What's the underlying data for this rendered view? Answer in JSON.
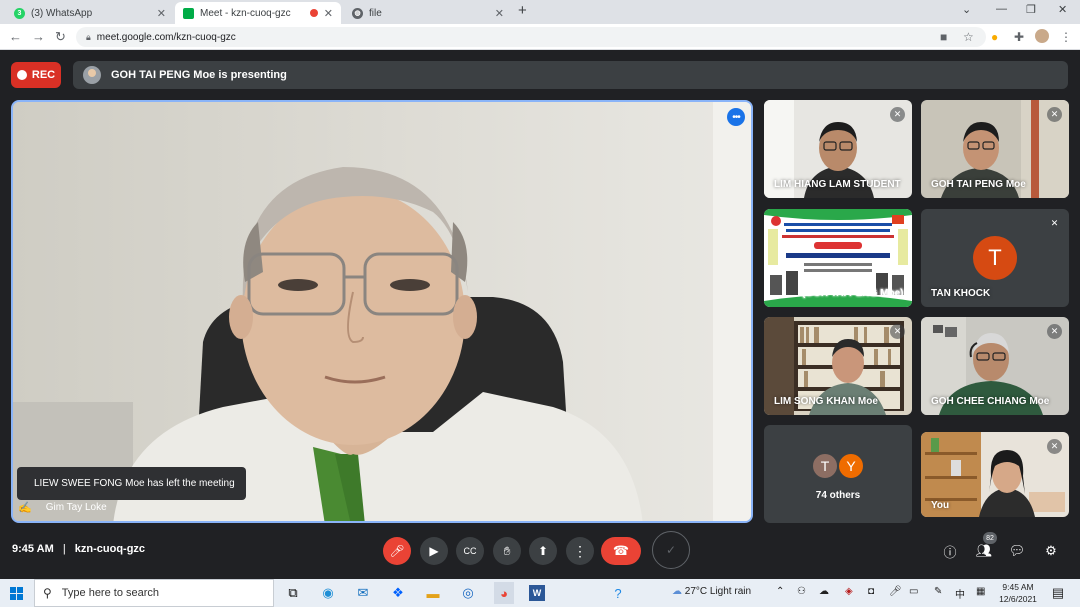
{
  "browser": {
    "tabs": [
      {
        "label": "(3) WhatsApp",
        "favicon": "whatsapp-icon",
        "active": false
      },
      {
        "label": "Meet - kzn-cuoq-gzc",
        "favicon": "meet-icon",
        "active": true
      },
      {
        "label": "file",
        "favicon": "globe-icon",
        "active": false
      }
    ],
    "url": "meet.google.com/kzn-cuoq-gzc"
  },
  "meet": {
    "rec_label": "REC",
    "presenting_text": "GOH TAI PENG Moe is presenting",
    "main_speaker": "Gim Tay Loke",
    "toast": "LIEW SWEE FONG Moe has left the meeting",
    "tiles": [
      {
        "name": "LIM HIANG LAM STUDENT"
      },
      {
        "name": "GOH TAI PENG Moe"
      },
      {
        "name": "(GOH TAI PENG Moe)"
      },
      {
        "name": "TAN KHOCK",
        "initial": "T"
      },
      {
        "name": "LIM SONG KHAN Moe"
      },
      {
        "name": "GOH CHEE CHIANG Moe"
      },
      {
        "name": "74 others",
        "initials": [
          "T",
          "Y"
        ]
      },
      {
        "name": "You"
      }
    ],
    "time": "9:45 AM",
    "meeting_code": "kzn-cuoq-gzc",
    "participant_count": "82"
  },
  "taskbar": {
    "search_placeholder": "Type here to search",
    "weather": "27°C  Light rain",
    "ime": "中",
    "clock_time": "9:45 AM",
    "clock_date": "12/6/2021"
  },
  "colors": {
    "accent": "#1a73e8",
    "rec_red": "#d93025",
    "end_call_red": "#ea4335",
    "tile_bg": "#3c4043",
    "initial_orange": "#d64a12"
  }
}
